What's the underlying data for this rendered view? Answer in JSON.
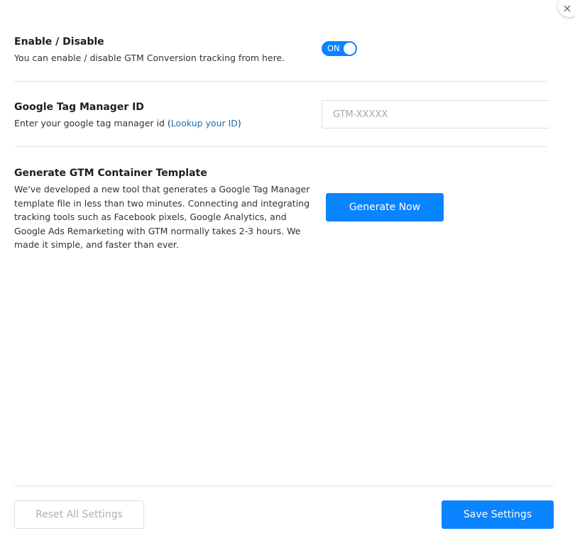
{
  "enable_section": {
    "title": "Enable / Disable",
    "description": "You can enable / disable GTM Conversion tracking from here.",
    "toggle_label": "ON",
    "toggle_state": true
  },
  "gtm_id_section": {
    "title": "Google Tag Manager ID",
    "description_prefix": "Enter your google tag manager id (",
    "lookup_link": "Lookup your ID",
    "description_suffix": ")",
    "input_value": "",
    "input_placeholder": "GTM-XXXXX"
  },
  "template_section": {
    "title": "Generate GTM Container Template",
    "description_lines": [
      "We've developed a new tool that generates a Google Tag Manager",
      "template file in less than two minutes. Connecting and integrating",
      "tracking tools such as Facebook pixels, Google Analytics, and",
      "Google Ads Remarketing with GTM normally takes 2-3 hours. We",
      "made it simple, and faster than ever."
    ],
    "button_label": "Generate Now"
  },
  "footer": {
    "reset_label": "Reset All Settings",
    "save_label": "Save Settings"
  },
  "colors": {
    "primary": "#0a84ff",
    "link": "#1a6fb8",
    "divider": "#e2e2e2"
  },
  "icons": {
    "close": "close-icon"
  }
}
